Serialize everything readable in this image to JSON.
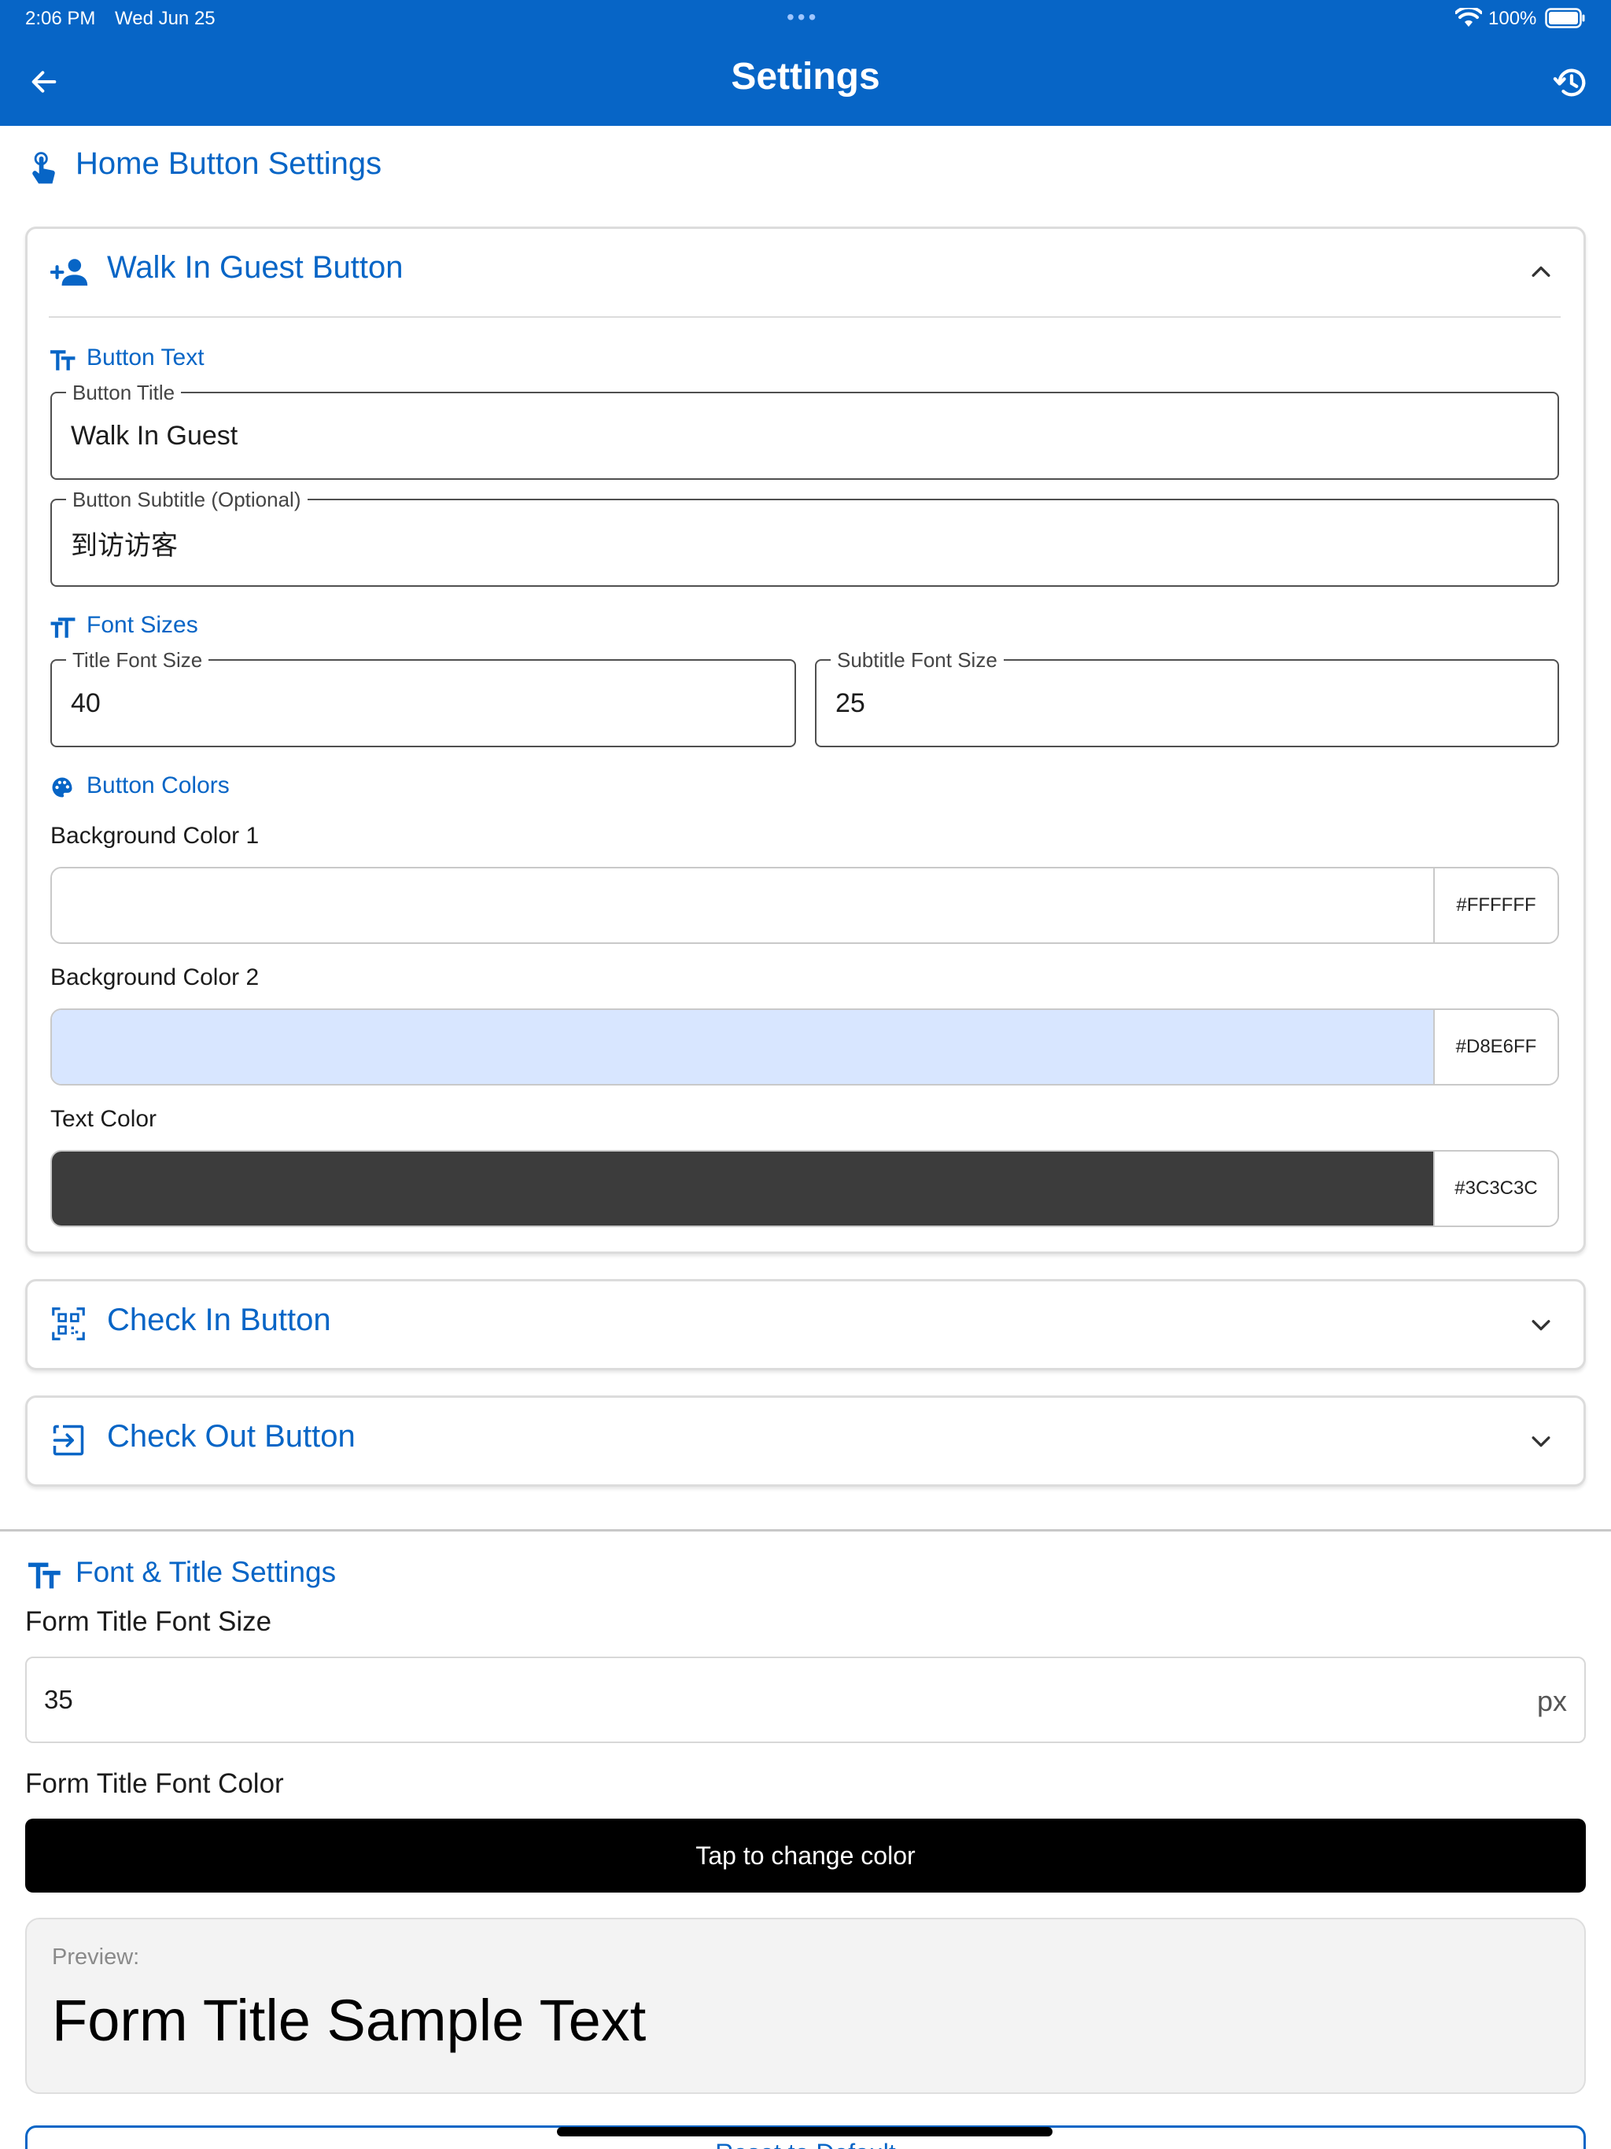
{
  "status_bar": {
    "time": "2:06 PM",
    "date": "Wed Jun 25",
    "dots": "•••",
    "battery": "100%"
  },
  "nav": {
    "title": "Settings"
  },
  "home_button_settings": {
    "title": "Home Button Settings",
    "walk_in": {
      "title": "Walk In Guest Button",
      "button_text_heading": "Button Text",
      "title_field": {
        "label": "Button Title",
        "value": "Walk In Guest"
      },
      "subtitle_field": {
        "label": "Button Subtitle (Optional)",
        "value": "到访访客"
      },
      "font_sizes_heading": "Font Sizes",
      "title_font_size": {
        "label": "Title Font Size",
        "value": "40"
      },
      "subtitle_font_size": {
        "label": "Subtitle Font Size",
        "value": "25"
      },
      "colors_heading": "Button Colors",
      "bg1": {
        "label": "Background Color 1",
        "hex": "#FFFFFF",
        "color": "#FFFFFF"
      },
      "bg2": {
        "label": "Background Color 2",
        "hex": "#D8E6FF",
        "color": "#D8E6FF"
      },
      "text_color": {
        "label": "Text Color",
        "hex": "#3C3C3C",
        "color": "#3C3C3C"
      }
    },
    "check_in": {
      "title": "Check In Button"
    },
    "check_out": {
      "title": "Check Out Button"
    }
  },
  "font_title_settings": {
    "title": "Font & Title Settings",
    "form_title_font_size_label": "Form Title Font Size",
    "form_title_font_size_value": "35",
    "unit": "px",
    "form_title_font_color_label": "Form Title Font Color",
    "color_button_label": "Tap to change color",
    "preview_label": "Preview:",
    "preview_text": "Form Title Sample Text"
  },
  "footer": {
    "partial_button_label": "Reset to Default"
  },
  "colors": {
    "primary": "#0765C6",
    "bg2": "#D8E6FF",
    "text_color": "#3C3C3C"
  }
}
